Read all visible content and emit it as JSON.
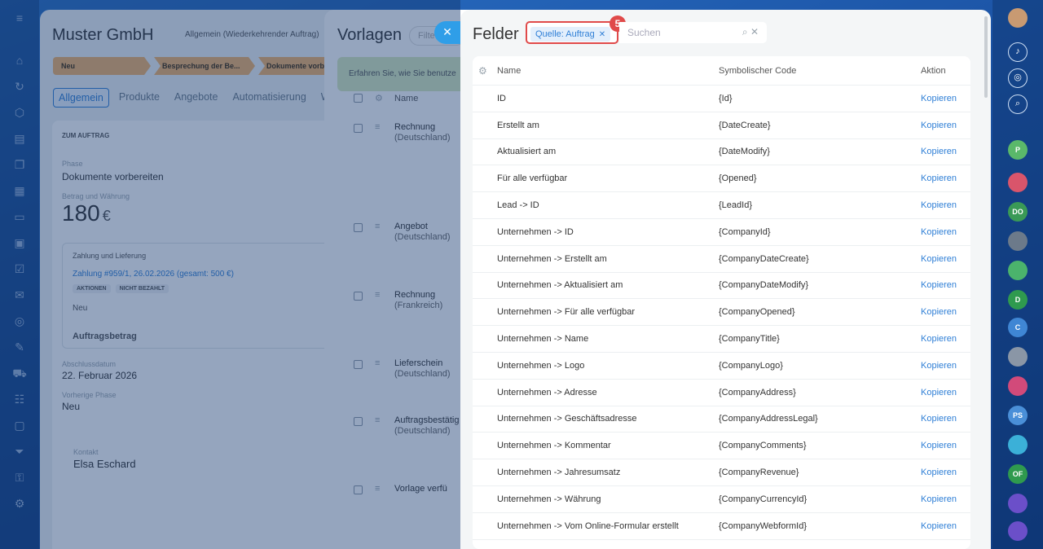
{
  "deal": {
    "title": "Muster GmbH",
    "subtitle": "Allgemein (Wiederkehrender Auftrag)",
    "stages": [
      "Neu",
      "Besprechung der Be...",
      "Dokumente vorbe"
    ],
    "tabs": [
      "Allgemein",
      "Produkte",
      "Angebote",
      "Automatisierung",
      "Wo"
    ],
    "section_title": "ZUM AUFTRAG",
    "phase_label": "Phase",
    "phase_value": "Dokumente vorbereiten",
    "amount_label": "Betrag und Währung",
    "amount_value": "180",
    "currency": "€",
    "payment_section": "Zahlung und Lieferung",
    "payment_link": "Zahlung #959/1, 26.02.2026 (gesamt: 500 €)",
    "badge_actions": "AKTIONEN",
    "badge_unpaid": "NICHT BEZAHLT",
    "payment_status": "Neu",
    "order_amount": "Auftragsbetrag",
    "close_date_label": "Abschlussdatum",
    "close_date": "22. Februar 2026",
    "prev_phase_label": "Vorherige Phase",
    "prev_phase": "Neu",
    "client_label": "Kontakt",
    "client_name": "Elsa Eschard"
  },
  "templates": {
    "title": "Vorlagen",
    "filter_placeholder": "Filte",
    "hint": "Erfahren Sie, wie Sie benutze",
    "header_name": "Name",
    "rows": [
      {
        "l1": "Rechnung",
        "l2": "(Deutschland)"
      },
      {
        "l1": "Angebot",
        "l2": "(Deutschland)"
      },
      {
        "l1": "Rechnung",
        "l2": "(Frankreich)"
      },
      {
        "l1": "Lieferschein",
        "l2": "(Deutschland)"
      },
      {
        "l1": "Auftragsbestätig",
        "l2": "(Deutschland)"
      },
      {
        "l1": "Vorlage verfü",
        "l2": ""
      }
    ]
  },
  "fields": {
    "title": "Felder",
    "filter_chip": "Quelle: Auftrag",
    "step_badge": "5",
    "search_placeholder": "Suchen",
    "col_name": "Name",
    "col_code": "Symbolischer Code",
    "col_action": "Aktion",
    "rows": [
      {
        "name": "ID",
        "code": "{Id}",
        "action": "Kopieren"
      },
      {
        "name": "Erstellt am",
        "code": "{DateCreate}",
        "action": "Kopieren"
      },
      {
        "name": "Aktualisiert am",
        "code": "{DateModify}",
        "action": "Kopieren"
      },
      {
        "name": "Für alle verfügbar",
        "code": "{Opened}",
        "action": "Kopieren"
      },
      {
        "name": "Lead -> ID",
        "code": "{LeadId}",
        "action": "Kopieren"
      },
      {
        "name": "Unternehmen -> ID",
        "code": "{CompanyId}",
        "action": "Kopieren"
      },
      {
        "name": "Unternehmen -> Erstellt am",
        "code": "{CompanyDateCreate}",
        "action": "Kopieren"
      },
      {
        "name": "Unternehmen -> Aktualisiert am",
        "code": "{CompanyDateModify}",
        "action": "Kopieren"
      },
      {
        "name": "Unternehmen -> Für alle verfügbar",
        "code": "{CompanyOpened}",
        "action": "Kopieren"
      },
      {
        "name": "Unternehmen -> Name",
        "code": "{CompanyTitle}",
        "action": "Kopieren"
      },
      {
        "name": "Unternehmen -> Logo",
        "code": "{CompanyLogo}",
        "action": "Kopieren"
      },
      {
        "name": "Unternehmen -> Adresse",
        "code": "{CompanyAddress}",
        "action": "Kopieren"
      },
      {
        "name": "Unternehmen -> Geschäftsadresse",
        "code": "{CompanyAddressLegal}",
        "action": "Kopieren"
      },
      {
        "name": "Unternehmen -> Kommentar",
        "code": "{CompanyComments}",
        "action": "Kopieren"
      },
      {
        "name": "Unternehmen -> Jahresumsatz",
        "code": "{CompanyRevenue}",
        "action": "Kopieren"
      },
      {
        "name": "Unternehmen -> Währung",
        "code": "{CompanyCurrencyId}",
        "action": "Kopieren"
      },
      {
        "name": "Unternehmen -> Vom Online-Formular erstellt",
        "code": "{CompanyWebformId}",
        "action": "Kopieren"
      }
    ]
  },
  "right_sidebar": {
    "avatars": [
      "P",
      "DO",
      "D",
      "C",
      "PS",
      "OF"
    ]
  },
  "colors": {
    "accent": "#2f7fd6",
    "highlight": "#e04a4a",
    "stage": "#f3b36a"
  }
}
